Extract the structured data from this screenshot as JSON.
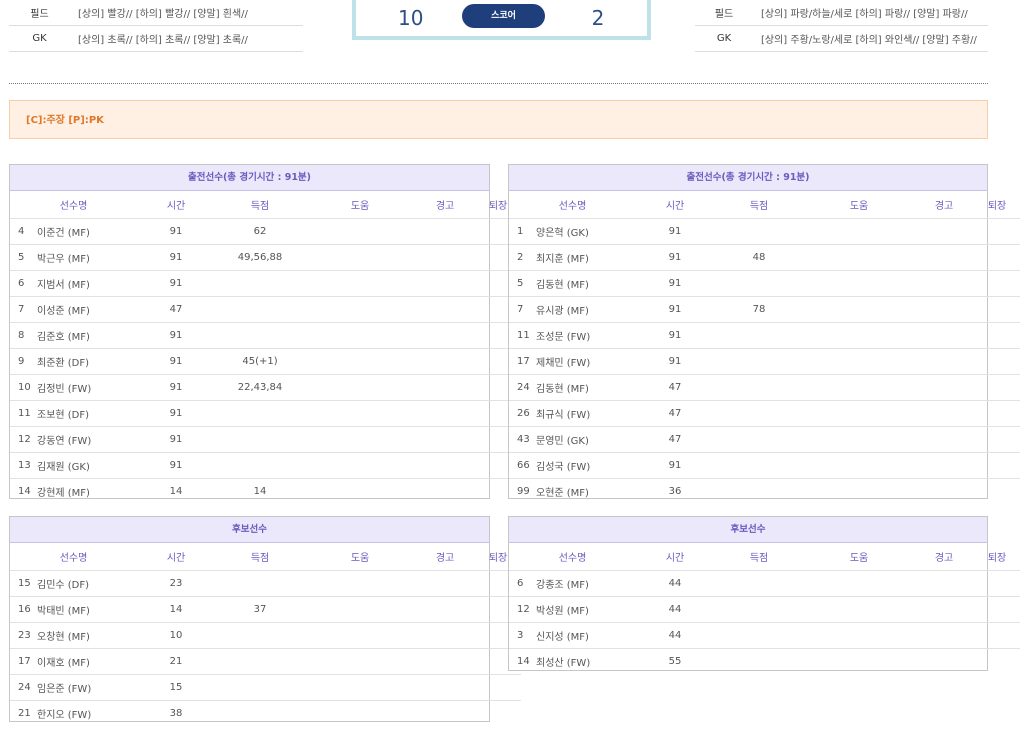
{
  "uniforms": {
    "home": [
      {
        "label": "필드",
        "value": "[상의] 빨강// [하의] 빨강// [양말] 흰색//"
      },
      {
        "label": "GK",
        "value": "[상의] 초록// [하의] 초록// [양말] 초록//"
      }
    ],
    "away": [
      {
        "label": "필드",
        "value": "[상의] 파랑/하늘/세로 [하의] 파랑// [양말] 파랑//"
      },
      {
        "label": "GK",
        "value": "[상의] 주황/노랑/세로 [하의] 와인색// [양말] 주황//"
      }
    ]
  },
  "score": {
    "home": "10",
    "label": "스코어",
    "away": "2"
  },
  "legend": "[C]:주장  [P]:PK",
  "columns": {
    "name": "선수명",
    "time": "시간",
    "goals": "득점",
    "assists": "도움",
    "warnings": "경고",
    "sendoff": "퇴장"
  },
  "lineup_home": {
    "title": "출전선수(총 경기시간 : 91분)",
    "rows": [
      {
        "num": "4",
        "name": "이준건 (MF)",
        "time": "91",
        "goals": "62"
      },
      {
        "num": "5",
        "name": "박근우 (MF)",
        "time": "91",
        "goals": "49,56,88"
      },
      {
        "num": "6",
        "name": "지범서 (MF)",
        "time": "91",
        "goals": ""
      },
      {
        "num": "7",
        "name": "이성준 (MF)",
        "time": "47",
        "goals": ""
      },
      {
        "num": "8",
        "name": "김준호 (MF)",
        "time": "91",
        "goals": ""
      },
      {
        "num": "9",
        "name": "최준환 (DF)",
        "time": "91",
        "goals": "45(+1)"
      },
      {
        "num": "10",
        "name": "김정빈 (FW)",
        "time": "91",
        "goals": "22,43,84"
      },
      {
        "num": "11",
        "name": "조보현 (DF)",
        "time": "91",
        "goals": ""
      },
      {
        "num": "12",
        "name": "강동연 (FW)",
        "time": "91",
        "goals": ""
      },
      {
        "num": "13",
        "name": "김재원 (GK)",
        "time": "91",
        "goals": ""
      },
      {
        "num": "14",
        "name": "강현제 (MF)",
        "time": "14",
        "goals": "14"
      }
    ]
  },
  "lineup_away": {
    "title": "출전선수(총 경기시간 : 91분)",
    "rows": [
      {
        "num": "1",
        "name": "양은혁 (GK)",
        "time": "91",
        "goals": ""
      },
      {
        "num": "2",
        "name": "최지훈 (MF)",
        "time": "91",
        "goals": "48"
      },
      {
        "num": "5",
        "name": "김동현 (MF)",
        "time": "91",
        "goals": ""
      },
      {
        "num": "7",
        "name": "유시광 (MF)",
        "time": "91",
        "goals": "78"
      },
      {
        "num": "11",
        "name": "조성문 (FW)",
        "time": "91",
        "goals": ""
      },
      {
        "num": "17",
        "name": "제채민 (FW)",
        "time": "91",
        "goals": ""
      },
      {
        "num": "24",
        "name": "김동현 (MF)",
        "time": "47",
        "goals": ""
      },
      {
        "num": "26",
        "name": "최규식 (FW)",
        "time": "47",
        "goals": ""
      },
      {
        "num": "43",
        "name": "문영민 (GK)",
        "time": "47",
        "goals": ""
      },
      {
        "num": "66",
        "name": "김성국 (FW)",
        "time": "91",
        "goals": ""
      },
      {
        "num": "99",
        "name": "오현준 (MF)",
        "time": "36",
        "goals": ""
      }
    ]
  },
  "subs_home": {
    "title": "후보선수",
    "rows": [
      {
        "num": "15",
        "name": "김민수 (DF)",
        "time": "23",
        "goals": ""
      },
      {
        "num": "16",
        "name": "박태빈 (MF)",
        "time": "14",
        "goals": "37"
      },
      {
        "num": "23",
        "name": "오창현 (MF)",
        "time": "10",
        "goals": ""
      },
      {
        "num": "17",
        "name": "이재호 (MF)",
        "time": "21",
        "goals": ""
      },
      {
        "num": "24",
        "name": "임은준 (FW)",
        "time": "15",
        "goals": ""
      },
      {
        "num": "21",
        "name": "한지오 (FW)",
        "time": "38",
        "goals": ""
      }
    ]
  },
  "subs_away": {
    "title": "후보선수",
    "rows": [
      {
        "num": "6",
        "name": "강종조 (MF)",
        "time": "44",
        "goals": ""
      },
      {
        "num": "12",
        "name": "박성원 (MF)",
        "time": "44",
        "goals": ""
      },
      {
        "num": "3",
        "name": "신지성 (MF)",
        "time": "44",
        "goals": ""
      },
      {
        "num": "14",
        "name": "최성산 (FW)",
        "time": "55",
        "goals": ""
      }
    ]
  }
}
